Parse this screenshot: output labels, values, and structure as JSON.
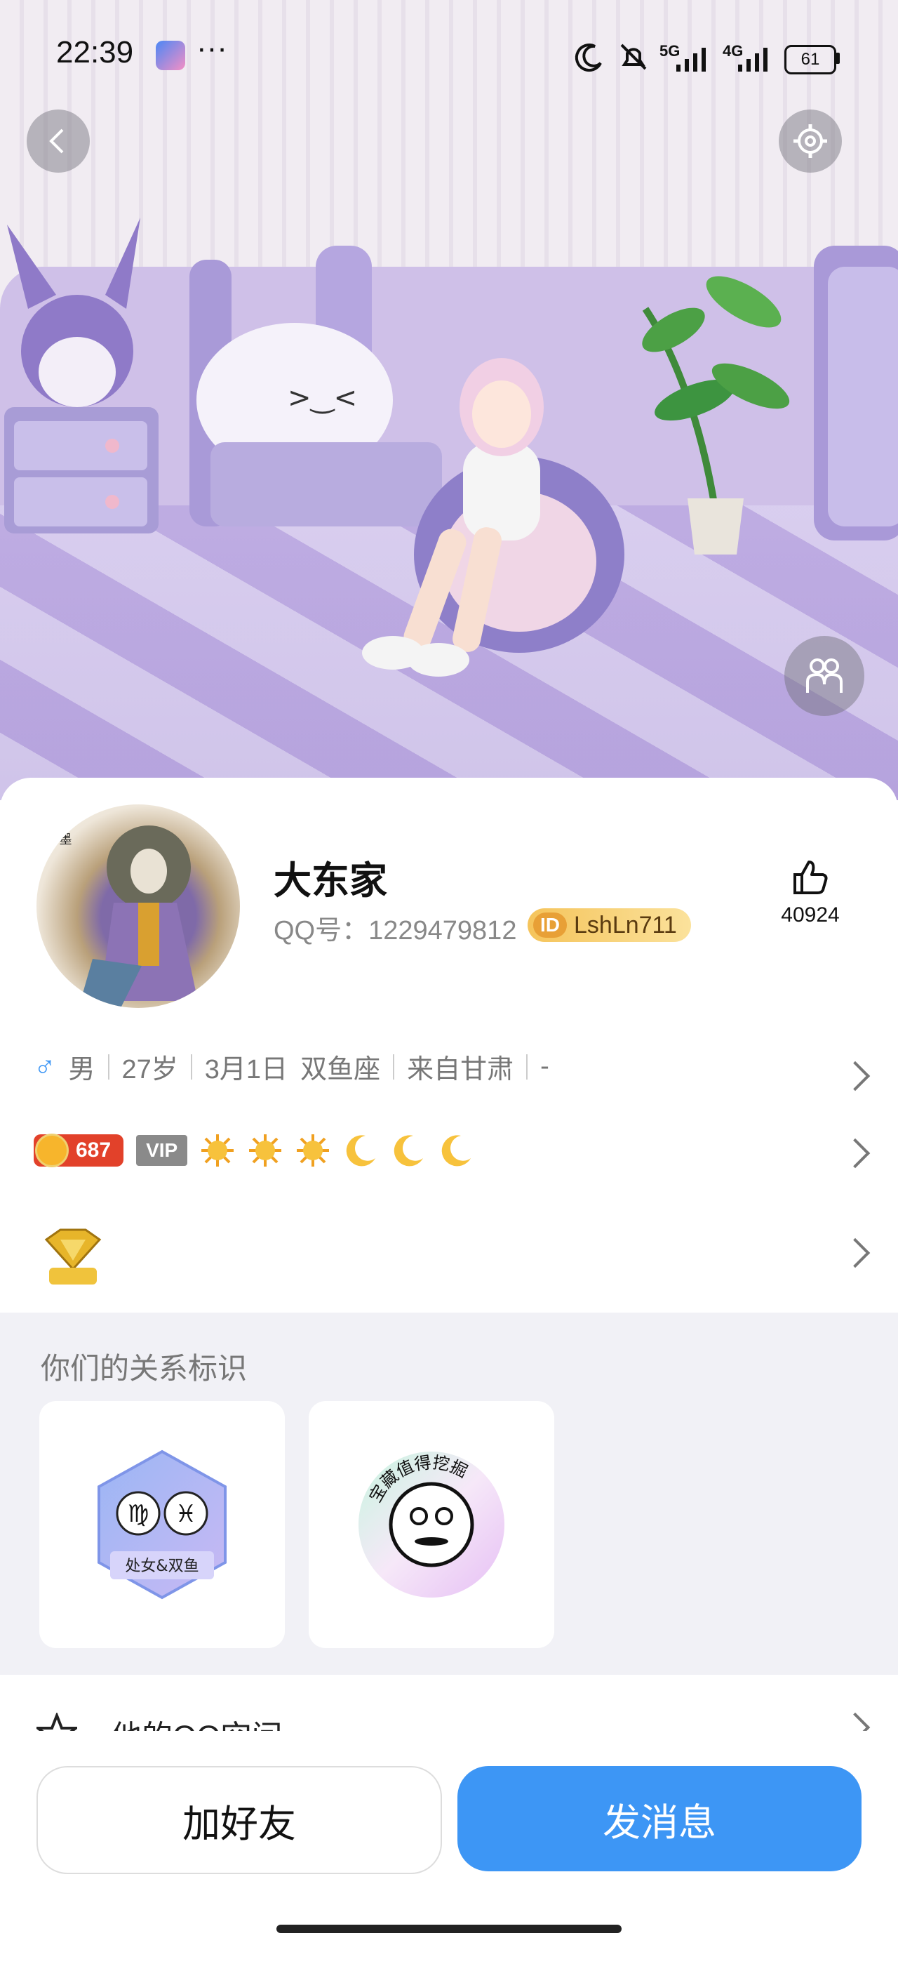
{
  "status_bar": {
    "time": "22:39",
    "more": "···",
    "network_5g": "5G",
    "network_4g": "4G",
    "battery": "61"
  },
  "header": {
    "back_icon": "chevron-left-icon",
    "settings_icon": "gear-icon",
    "avatar_switch_icon": "avatar-couple-icon"
  },
  "profile": {
    "name": "大东家",
    "qq_label": "QQ号：1229479812",
    "id_badge_prefix": "ID",
    "id_badge_value": "LshLn711",
    "likes": "40924",
    "gender_symbol": "♂",
    "info": [
      "男",
      "27岁",
      "3月1日",
      "双鱼座",
      "来自甘肃",
      "-"
    ],
    "coin_level": "687",
    "vip_label": "VIP"
  },
  "relation": {
    "title": "你们的关系标识",
    "tags": [
      {
        "label": "处女&双鱼",
        "symbols": "♍♓"
      },
      {
        "label": "宝藏值得挖掘"
      }
    ]
  },
  "qzone_label": "他的QQ空间",
  "actions": {
    "add_friend": "加好友",
    "send_message": "发消息"
  },
  "colors": {
    "primary": "#3d96f5",
    "coin": "#e2412a",
    "badge": "#f5c45b"
  }
}
